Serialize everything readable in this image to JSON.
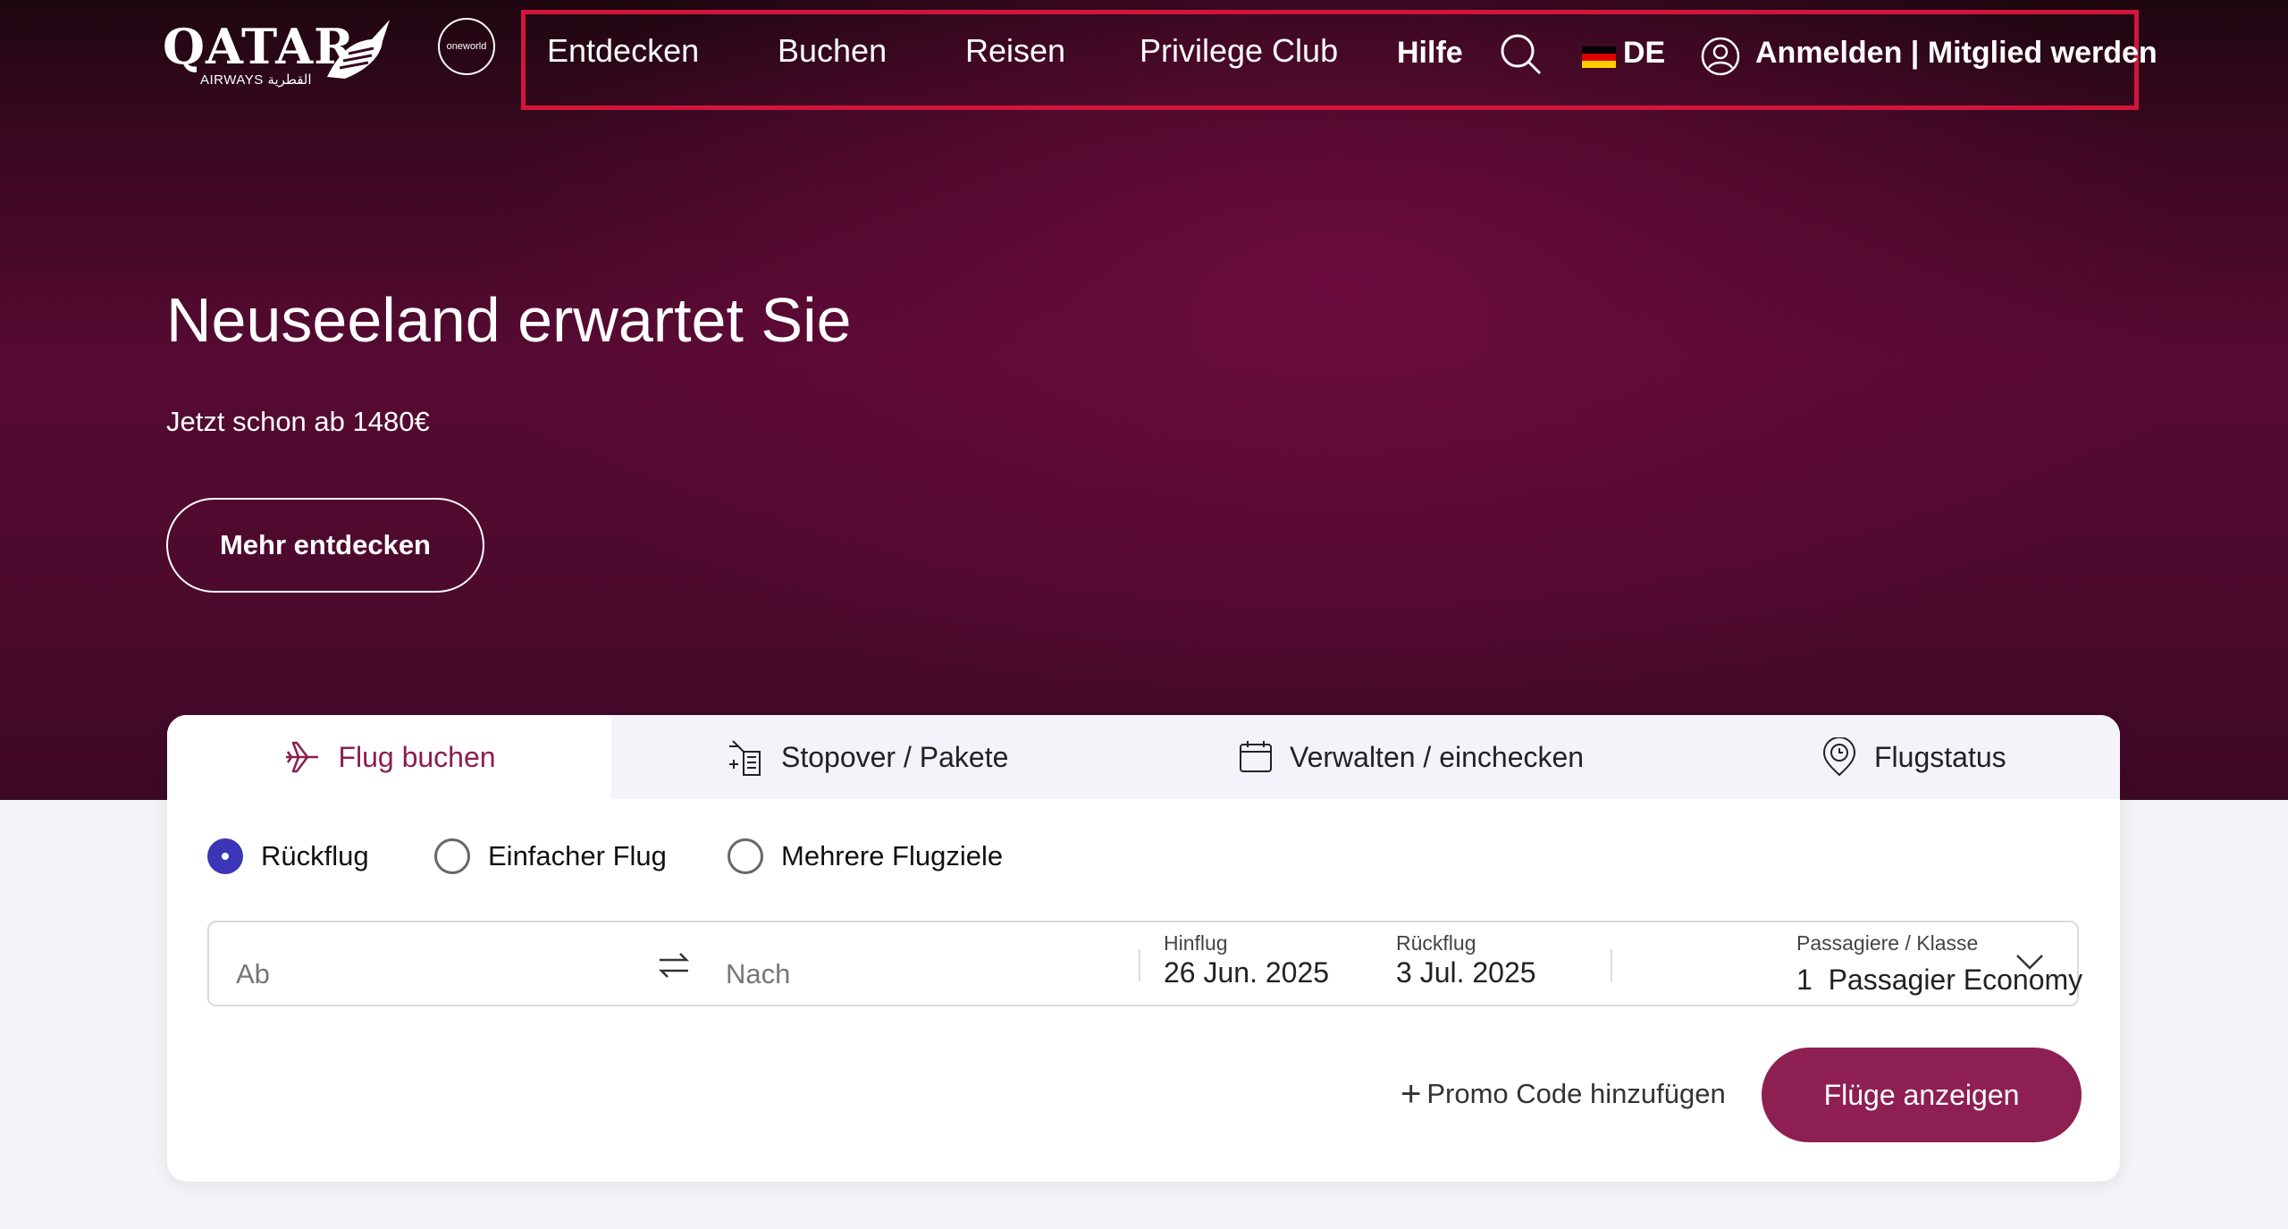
{
  "brand": {
    "logo_word": "QATAR",
    "logo_sub": "AIRWAYS القطرية",
    "alliance": "oneworld"
  },
  "nav": {
    "items": [
      "Entdecken",
      "Buchen",
      "Reisen",
      "Privilege Club",
      "Hilfe"
    ],
    "language": "DE",
    "login": "Anmelden | Mitglied werden"
  },
  "hero": {
    "title": "Neuseeland erwartet Sie",
    "subtitle": "Jetzt schon ab 1480€",
    "cta": "Mehr entdecken"
  },
  "booking": {
    "tabs": [
      "Flug buchen",
      "Stopover / Pakete",
      "Verwalten / einchecken",
      "Flugstatus"
    ],
    "active_tab": "Flug buchen",
    "trip_types": [
      "Rückflug",
      "Einfacher Flug",
      "Mehrere Flugziele"
    ],
    "selected_trip_type": "Rückflug",
    "from_placeholder": "Ab",
    "to_placeholder": "Nach",
    "depart_label": "Hinflug",
    "depart_value": "26 Jun. 2025",
    "return_label": "Rückflug",
    "return_value": "3 Jul. 2025",
    "pax_label": "Passagiere / Klasse",
    "pax_count": "1",
    "pax_value": "Passagier Economy",
    "promo": "Promo Code hinzufügen",
    "submit": "Flüge anzeigen"
  },
  "colors": {
    "hero_maroon": "#560a32",
    "accent": "#8e1f52",
    "highlight_frame": "#d2153d",
    "radio_selected": "#3b35b8"
  },
  "icons": [
    "search-icon",
    "user-icon",
    "plane-icon",
    "hotel-icon",
    "calendar-icon",
    "location-clock-icon",
    "swap-icon",
    "chevron-down-icon"
  ]
}
